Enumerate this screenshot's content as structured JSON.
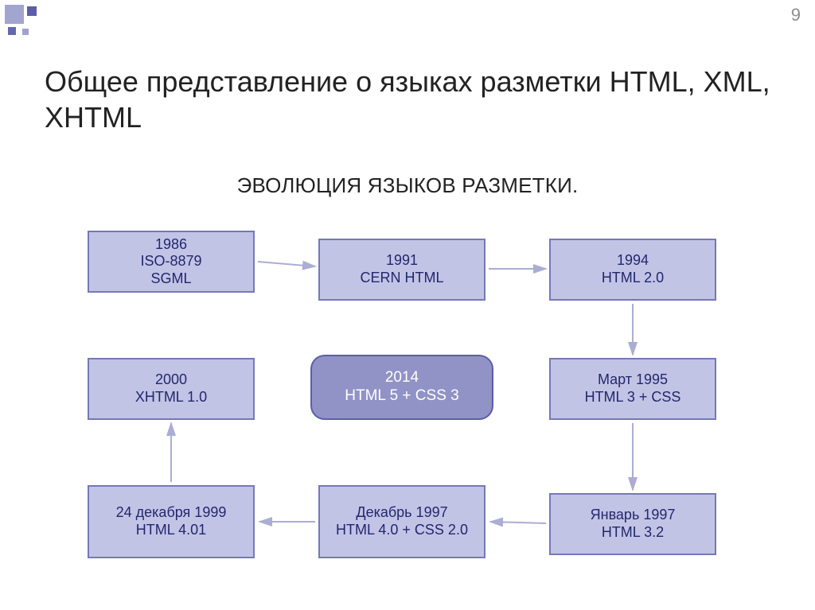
{
  "page_number": "9",
  "title": "Общее представление о языках разметки HTML, XML, XHTML",
  "subtitle": "ЭВОЛЮЦИЯ ЯЗЫКОВ РАЗМЕТКИ.",
  "nodes": {
    "n1": "1986\nISO-8879\nSGML",
    "n2": "1991\nCERN HTML",
    "n3": "1994\nHTML 2.0",
    "n4": "Март 1995\nHTML 3 +  CSS",
    "n5": "Январь 1997\nHTML 3.2",
    "n6": "Декабрь 1997\nHTML 4.0 + CSS 2.0",
    "n7": "24 декабря 1999\nHTML 4.01",
    "n8": "2000\nXHTML 1.0",
    "n9": "2014\nHTML 5 + CSS 3"
  },
  "chart_data": {
    "type": "diagram",
    "title": "ЭВОЛЮЦИЯ ЯЗЫКОВ РАЗМЕТКИ.",
    "nodes": [
      {
        "id": "n1",
        "label": "1986 ISO-8879 SGML"
      },
      {
        "id": "n2",
        "label": "1991 CERN HTML"
      },
      {
        "id": "n3",
        "label": "1994 HTML 2.0"
      },
      {
        "id": "n4",
        "label": "Март 1995 HTML 3 + CSS"
      },
      {
        "id": "n5",
        "label": "Январь 1997 HTML 3.2"
      },
      {
        "id": "n6",
        "label": "Декабрь 1997 HTML 4.0 + CSS 2.0"
      },
      {
        "id": "n7",
        "label": "24 декабря 1999 HTML 4.01"
      },
      {
        "id": "n8",
        "label": "2000 XHTML 1.0"
      },
      {
        "id": "n9",
        "label": "2014 HTML 5 + CSS 3"
      }
    ],
    "edges": [
      {
        "from": "n1",
        "to": "n2"
      },
      {
        "from": "n2",
        "to": "n3"
      },
      {
        "from": "n3",
        "to": "n4"
      },
      {
        "from": "n4",
        "to": "n5"
      },
      {
        "from": "n5",
        "to": "n6"
      },
      {
        "from": "n6",
        "to": "n7"
      },
      {
        "from": "n7",
        "to": "n8"
      }
    ]
  }
}
